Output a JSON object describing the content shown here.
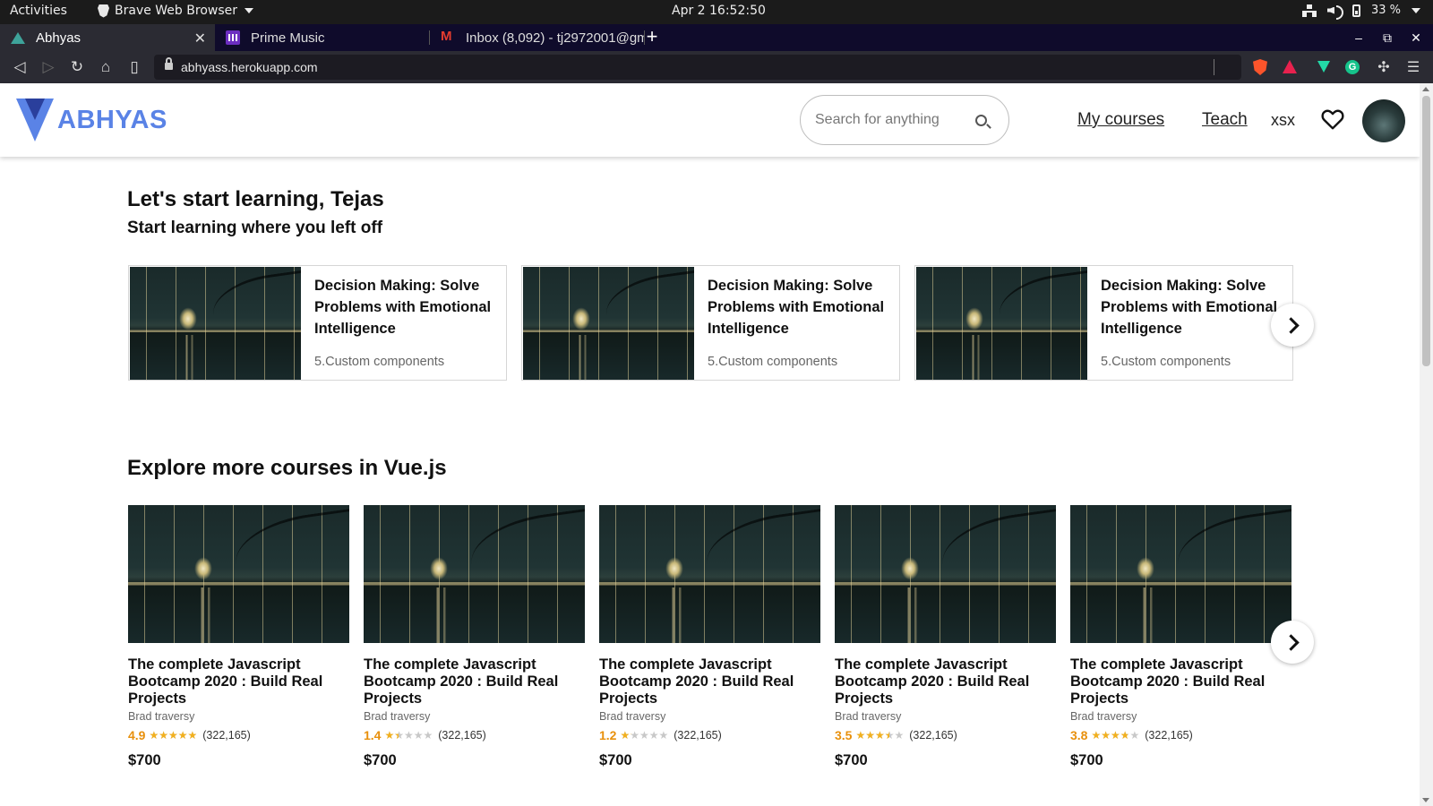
{
  "system_bar": {
    "activities": "Activities",
    "app_name": "Brave Web Browser",
    "clock": "Apr 2  16:52:50",
    "battery": "33 %"
  },
  "browser": {
    "tabs": [
      {
        "title": "Abhyas",
        "icon": "abhyas-favicon",
        "active": true
      },
      {
        "title": "Prime Music",
        "icon": "prime-music-favicon",
        "active": false
      },
      {
        "title": "Inbox (8,092) - tj2972001@gm",
        "icon": "gmail-favicon",
        "active": false
      }
    ],
    "new_tab": "+",
    "url": "abhyass.herokuapp.com",
    "window_controls": {
      "minimize": "–",
      "restore": "⧉",
      "close": "✕"
    }
  },
  "header": {
    "logo_text": "ABHYAS",
    "search_placeholder": "Search for anything",
    "nav": {
      "my_courses": "My courses",
      "teach": "Teach"
    },
    "username": "xsx",
    "accent_color": "#5a83e6"
  },
  "main": {
    "greeting": "Let's start learning, Tejas",
    "subheading": "Start learning where you left off",
    "resume_courses": [
      {
        "title": "Decision Making: Solve Problems with Emotional Intelligence",
        "lesson": "5.Custom components"
      },
      {
        "title": "Decision Making: Solve Problems with Emotional Intelligence",
        "lesson": "5.Custom components"
      },
      {
        "title": "Decision Making: Solve Problems with Emotional Intelligence",
        "lesson": "5.Custom components"
      }
    ],
    "explore_title": "Explore more courses in Vue.js",
    "courses": [
      {
        "title": "The complete Javascript Bootcamp 2020 : Build Real Projects",
        "author": "Brad traversy",
        "rating": "4.9",
        "rating_value": 4.9,
        "reviews": "(322,165)",
        "price": "$700"
      },
      {
        "title": "The complete Javascript Bootcamp 2020 : Build Real Projects",
        "author": "Brad traversy",
        "rating": "1.4",
        "rating_value": 1.4,
        "reviews": "(322,165)",
        "price": "$700"
      },
      {
        "title": "The complete Javascript Bootcamp 2020 : Build Real Projects",
        "author": "Brad traversy",
        "rating": "1.2",
        "rating_value": 1.2,
        "reviews": "(322,165)",
        "price": "$700"
      },
      {
        "title": "The complete Javascript Bootcamp 2020 : Build Real Projects",
        "author": "Brad traversy",
        "rating": "3.5",
        "rating_value": 3.5,
        "reviews": "(322,165)",
        "price": "$700"
      },
      {
        "title": "The complete Javascript Bootcamp 2020 : Build Real Projects",
        "author": "Brad traversy",
        "rating": "3.8",
        "rating_value": 3.8,
        "reviews": "(322,165)",
        "price": "$700"
      }
    ]
  }
}
